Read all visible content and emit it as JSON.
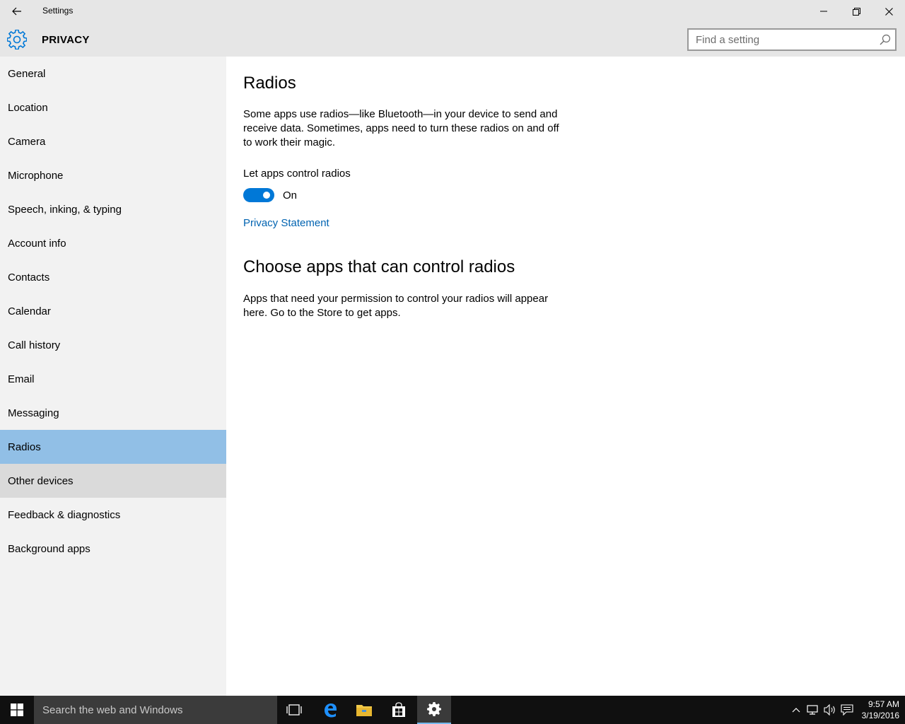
{
  "window": {
    "title": "Settings"
  },
  "header": {
    "section_title": "PRIVACY",
    "search_placeholder": "Find a setting"
  },
  "sidebar": {
    "items": [
      {
        "label": "General"
      },
      {
        "label": "Location"
      },
      {
        "label": "Camera"
      },
      {
        "label": "Microphone"
      },
      {
        "label": "Speech, inking, & typing"
      },
      {
        "label": "Account info"
      },
      {
        "label": "Contacts"
      },
      {
        "label": "Calendar"
      },
      {
        "label": "Call history"
      },
      {
        "label": "Email"
      },
      {
        "label": "Messaging"
      },
      {
        "label": "Radios"
      },
      {
        "label": "Other devices"
      },
      {
        "label": "Feedback & diagnostics"
      },
      {
        "label": "Background apps"
      }
    ],
    "selected": "Radios"
  },
  "content": {
    "title": "Radios",
    "description": "Some apps use radios—like Bluetooth—in your device to send and receive data. Sometimes, apps need to turn these radios on and off to work their magic.",
    "toggle_label": "Let apps control radios",
    "toggle_state": "On",
    "privacy_link": "Privacy Statement",
    "section2_title": "Choose apps that can control radios",
    "section2_description": "Apps that need your permission to control your radios will appear here. Go to the Store to get apps."
  },
  "taskbar": {
    "search_placeholder": "Search the web and Windows",
    "time": "9:57 AM",
    "date": "3/19/2016"
  },
  "colors": {
    "accent": "#0078d7",
    "selected_nav": "#91bfe6",
    "link": "#0063b1"
  }
}
